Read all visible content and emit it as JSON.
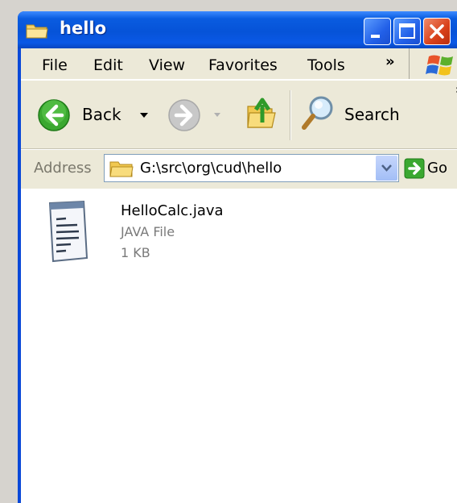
{
  "window": {
    "title": "hello"
  },
  "menu": {
    "items": [
      "File",
      "Edit",
      "View",
      "Favorites",
      "Tools"
    ],
    "more": "»"
  },
  "toolbar": {
    "back_label": "Back",
    "search_label": "Search",
    "more": "»"
  },
  "address": {
    "label": "Address",
    "value": "G:\\src\\org\\cud\\hello",
    "go_label": "Go"
  },
  "files": [
    {
      "name": "HelloCalc.java",
      "type": "JAVA File",
      "size": "1 KB",
      "icon": "notepad-document-icon"
    }
  ],
  "colors": {
    "titlebar": "#0a5ce0",
    "chrome": "#ece9d8",
    "close_button": "#d8401a",
    "content_bg": "#ffffff",
    "secondary_text": "#7a7a7a"
  }
}
